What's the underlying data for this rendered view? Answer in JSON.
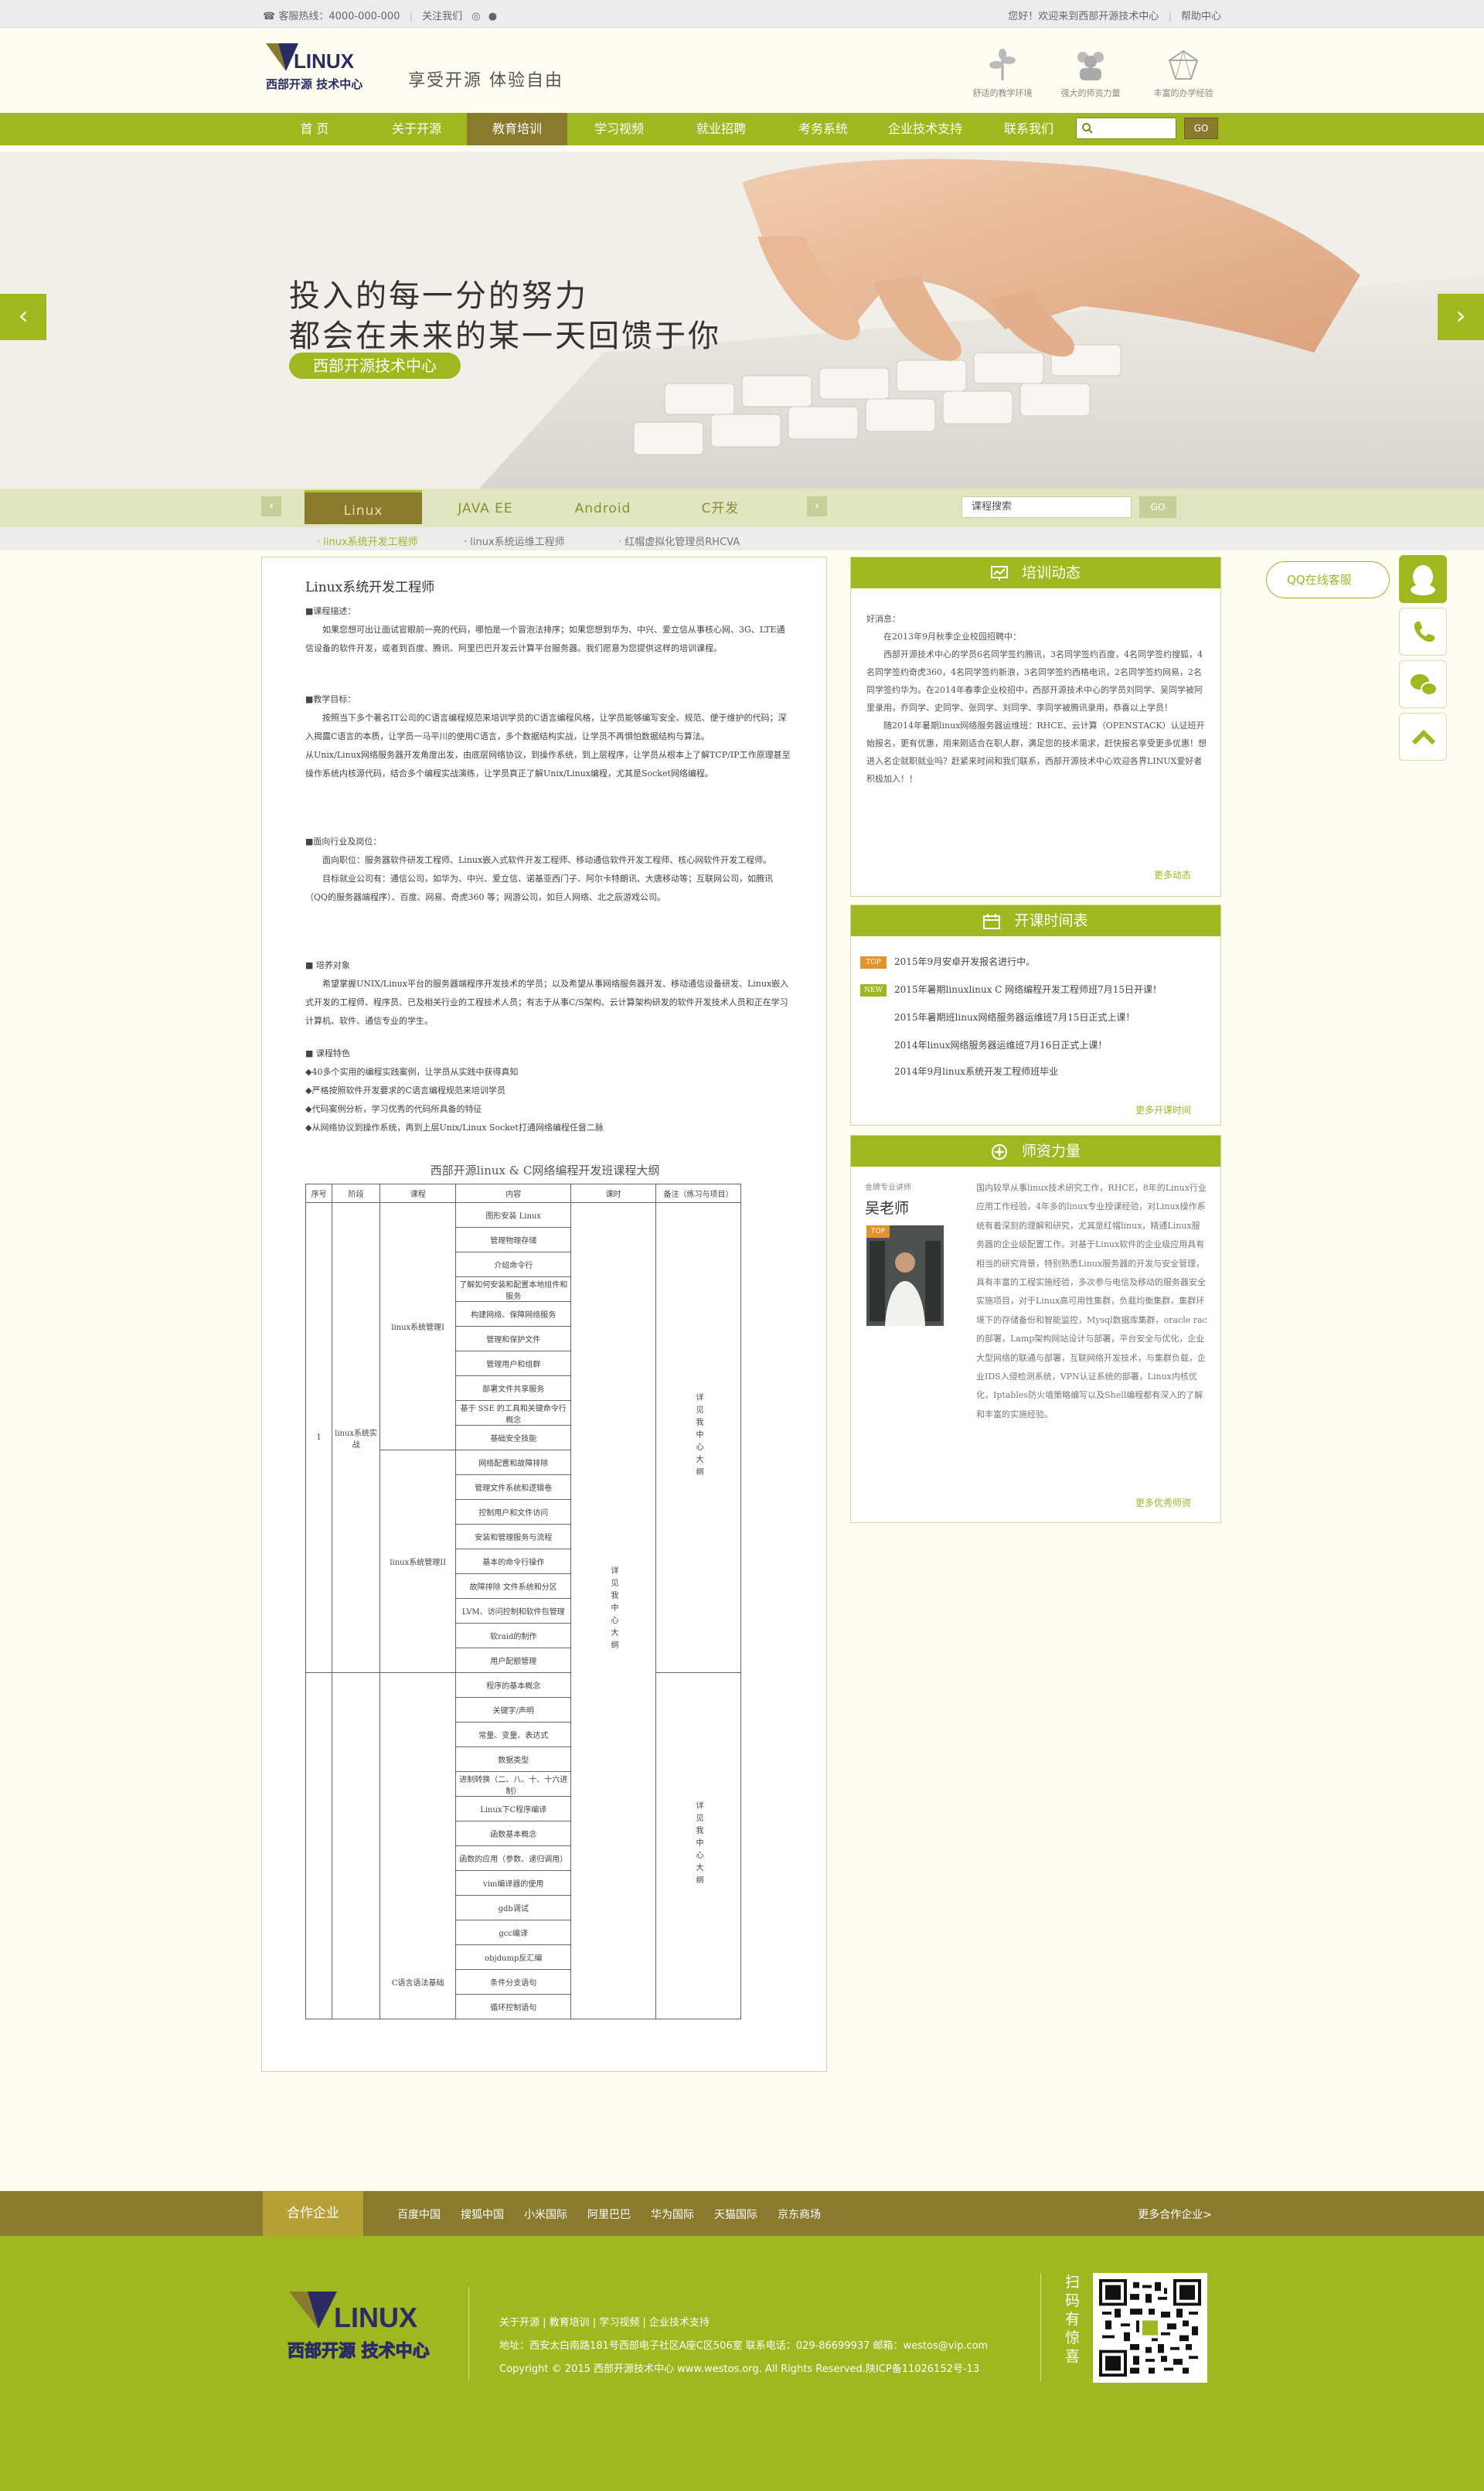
{
  "topbar": {
    "hotline": "客服热线：4000-000-000",
    "follow": "关注我们",
    "welcome": "您好！欢迎来到西部开源技术中心",
    "help": "帮助中心"
  },
  "header": {
    "logo_text": "LINUX",
    "logo_cn": "西部开源 技术中心",
    "slogan": "享受开源  体验自由",
    "features": [
      "舒适的教学环境",
      "强大的师资力量",
      "丰富的办学经验"
    ]
  },
  "nav": {
    "items": [
      "首  页",
      "关于开源",
      "教育培训",
      "学习视频",
      "就业招聘",
      "考务系统",
      "企业技术支持",
      "联系我们"
    ],
    "active_index": 2,
    "search_go": "GO"
  },
  "banner": {
    "line1": "投入的每一分的努力",
    "line2": "都会在未来的某一天回馈于你",
    "pill": "西部开源技术中心",
    "prev": "‹",
    "next": "›"
  },
  "course_tabs": {
    "tabs": [
      "Linux",
      "JAVA EE",
      "Android",
      "C开发"
    ],
    "active_index": 0,
    "search_value": "课程搜索",
    "search_go": "GO"
  },
  "subnav": [
    "· linux系统开发工程师",
    "· linux系统运维工程师",
    "· 红帽虚拟化管理员RHCVA"
  ],
  "content": {
    "title": "Linux系统开发工程师",
    "sec1_title": "■课程描述：",
    "sec1_body": "如果您想可出让面试官眼前一亮的代码，哪怕是一个冒泡法排序；如果您想到华为、中兴、爱立信从事核心网、3G、LTE通信设备的软件开发，或者到百度、腾讯、阿里巴巴开发云计算平台服务器。我们愿意为您提供这样的培训课程。",
    "sec2_title": "■教学目标：",
    "sec2_body1": "按照当下多个著名IT公司的C语言编程规范来培训学员的C语言编程风格，让学员能够编写安全、规范、便于维护的代码；深入揭露C语言的本质，让学员一马平川的使用C语言，多个数据结构实战，让学员不再惧怕数据结构与算法。",
    "sec2_body2": "从Unix/Linux网络服务器开发角度出发，由底层网络协议，到操作系统，到上层程序，让学员从根本上了解TCP/IP工作原理甚至操作系统内核源代码，结合多个编程实战演练，让学员真正了解Unix/Linux编程，尤其是Socket网络编程。",
    "sec3_title": "■面向行业及岗位：",
    "sec3_body1": "面向职位：服务器软件研发工程师、Linux嵌入式软件开发工程师、移动通信软件开发工程师、核心网软件开发工程师。",
    "sec3_body2": "目标就业公司有：通信公司，如华为、中兴、爱立信、诺基亚西门子、阿尔卡特朗讯、大唐移动等；互联网公司，如腾讯（QQ的服务器端程序）、百度、网易、奇虎360  等；网游公司，如巨人网络、北之辰游戏公司。",
    "sec4_title": "■  培养对象",
    "sec4_body": "希望掌握UNIX/Linux平台的服务器端程序开发技术的学员；以及希望从事网络服务器开发、移动通信设备研发、Linux嵌入式开发的工程师、程序员、已及相关行业的工程技术人员；有志于从事C/S架构、云计算架构研发的软件开发技术人员和正在学习计算机、软件、通信专业的学生。",
    "sec5_title": "■  课程特色",
    "features": [
      "◆40多个实用的编程实践案例，让学员从实践中获得真知",
      "◆严格按照软件开发要求的C语言编程规范来培训学员",
      "◆代码案例分析，学习优秀的代码所具备的特征",
      "◆从网络协议到操作系统，再到上层Unix/Linux Socket打通网络编程任督二脉"
    ],
    "table_title": "西部开源linux & C网络编程开发班课程大纲",
    "table_headers": [
      "序号",
      "阶段",
      "课程",
      "内容",
      "课时",
      "备注（练习与项目）"
    ],
    "row_no": "1",
    "stage": "linux系统实战",
    "course1": "linux系统管理I",
    "course2": "linux系统管理II",
    "course3": "C语言语法基础",
    "remark": "详见我中心大纲",
    "hours": "详见我中心大纲",
    "items1": [
      "图形安装 Linux",
      "管理物理存储",
      "介绍命令行",
      "了解如何安装和配置本地组件和服务",
      "构建网络、保障网络服务",
      "管理和保护文件",
      "管理用户和组群",
      "部署文件共享服务",
      "基于 SSE 的工具和关键命令行概念",
      "基础安全技能"
    ],
    "items2": [
      "网络配置和故障排除",
      "管理文件系统和逻辑卷",
      "控制用户和文件访问",
      "安装和管理服务与流程",
      "基本的命令行操作",
      "故障排除 文件系统和分区",
      "LVM、访问控制和软件包管理",
      "软raid的制作",
      "用户配额管理"
    ],
    "items3": [
      "程序的基本概念",
      "关键字/声明",
      "常量、变量、表达式",
      "数据类型",
      "进制转换（二、八、十、十六进制）",
      "Linux下C程序编译",
      "函数基本概念",
      "函数的应用（参数、递归调用）",
      "vim编译器的使用",
      "gdb调试",
      "gcc编译",
      "objdump反汇编",
      "条件分支语句",
      "循环控制语句"
    ]
  },
  "news": {
    "title": "培训动态",
    "greeting": "好消息：",
    "paras": [
      "在2013年9月秋季企业校园招聘中：",
      "西部开源技术中心的学员6名同学签约腾讯，3名同学签约百度，4名同学签约搜狐，4名同学签约奇虎360，4名同学签约新浪，3名同学签约西格电讯，2名同学签约网易，2名同学签约华为。在2014年春季企业校招中，西部开源技术中心的学员刘同学、吴同学被阿里录用，乔同学、史同学、张同学、刘同学、李同学被腾讯录用，恭喜以上学员！",
      "随2014年暑期linux网络服务器运维班：RHCE、云计算（OPENSTACK）认证班开始报名，更有优惠，用来刚适合在职人群，满足您的技术需求，赶快报名享受更多优惠！想进入名企就职就业吗？赶紧来时间和我们联系，西部开源技术中心欢迎各界LINUX爱好者积极加入！！"
    ],
    "more": "更多动态"
  },
  "schedule": {
    "title": "开课时间表",
    "items": [
      {
        "badge": "TOP",
        "color": "#e4932b",
        "text": "2015年9月安卓开发报名进行中。"
      },
      {
        "badge": "NEW",
        "color": "#9fb81f",
        "text": "2015年暑期linuxlinux C 网络编程开发工程师班7月15日开课！"
      },
      {
        "badge": "",
        "color": "",
        "text": "2015年暑期班linux网络服务器运维班7月15日正式上课！"
      },
      {
        "badge": "",
        "color": "",
        "text": "2014年linux网络服务器运维班7月16日正式上课！"
      },
      {
        "badge": "",
        "color": "",
        "text": "2014年9月linux系统开发工程师班毕业"
      }
    ],
    "more": "更多开课时间"
  },
  "teachers": {
    "title": "师资力量",
    "role": "金牌专业讲师",
    "name": "吴老师",
    "photo_badge": "TOP",
    "bio": "国内较早从事linux技术研究工作，RHCE，8年的Linux行业应用工作经验，4年多的linux专业授课经验，对Linux操作系统有着深刻的理解和研究，尤其是红帽linux，精通Linux服务器的企业级配置工作。对基于Linux软件的企业级应用具有相当的研究背景，特别熟悉Linux服务器的开发与安全管理，具有丰富的工程实施经验，多次参与电信及移动的服务器安全实施项目，对于Linux高可用性集群，负载均衡集群，集群环境下的存储备份和智能监控，Mysql数据库集群，oracle rac的部署，Lamp架构网站设计与部署，平台安全与优化，企业大型网络的联通与部署，互联网络开发技术，与集群负载，企业IDS入侵检测系统，VPN认证系统的部署，Linux内核优化，Iptables防火墙策略编写以及Shell编程都有深入的了解和丰富的实施经验。",
    "more": "更多优秀师资"
  },
  "float_service": {
    "qq": "QQ在线客服"
  },
  "partners": {
    "label": "合作企业",
    "items": [
      "百度中国",
      "搜狐中国",
      "小米国际",
      "阿里巴巴",
      "华为国际",
      "天猫国际",
      "京东商场"
    ],
    "more": "更多合作企业>"
  },
  "footer": {
    "links": "关于开源  |  教育培训  |  学习视频  |  企业技术支持",
    "address": "地址：西安太白南路181号西部电子社区A座C区506室   联系电话：029-86699937   邮箱：westos@vip.com",
    "copyright": "Copyright © 2015 西部开源技术中心 www.westos.org. All Rights Reserved.陕ICP备11026152号-13",
    "scan": "扫码有惊喜"
  },
  "colors": {
    "brand_green": "#9fb81f",
    "brand_brown": "#8a7a2e",
    "badge_top": "#e4932b"
  }
}
